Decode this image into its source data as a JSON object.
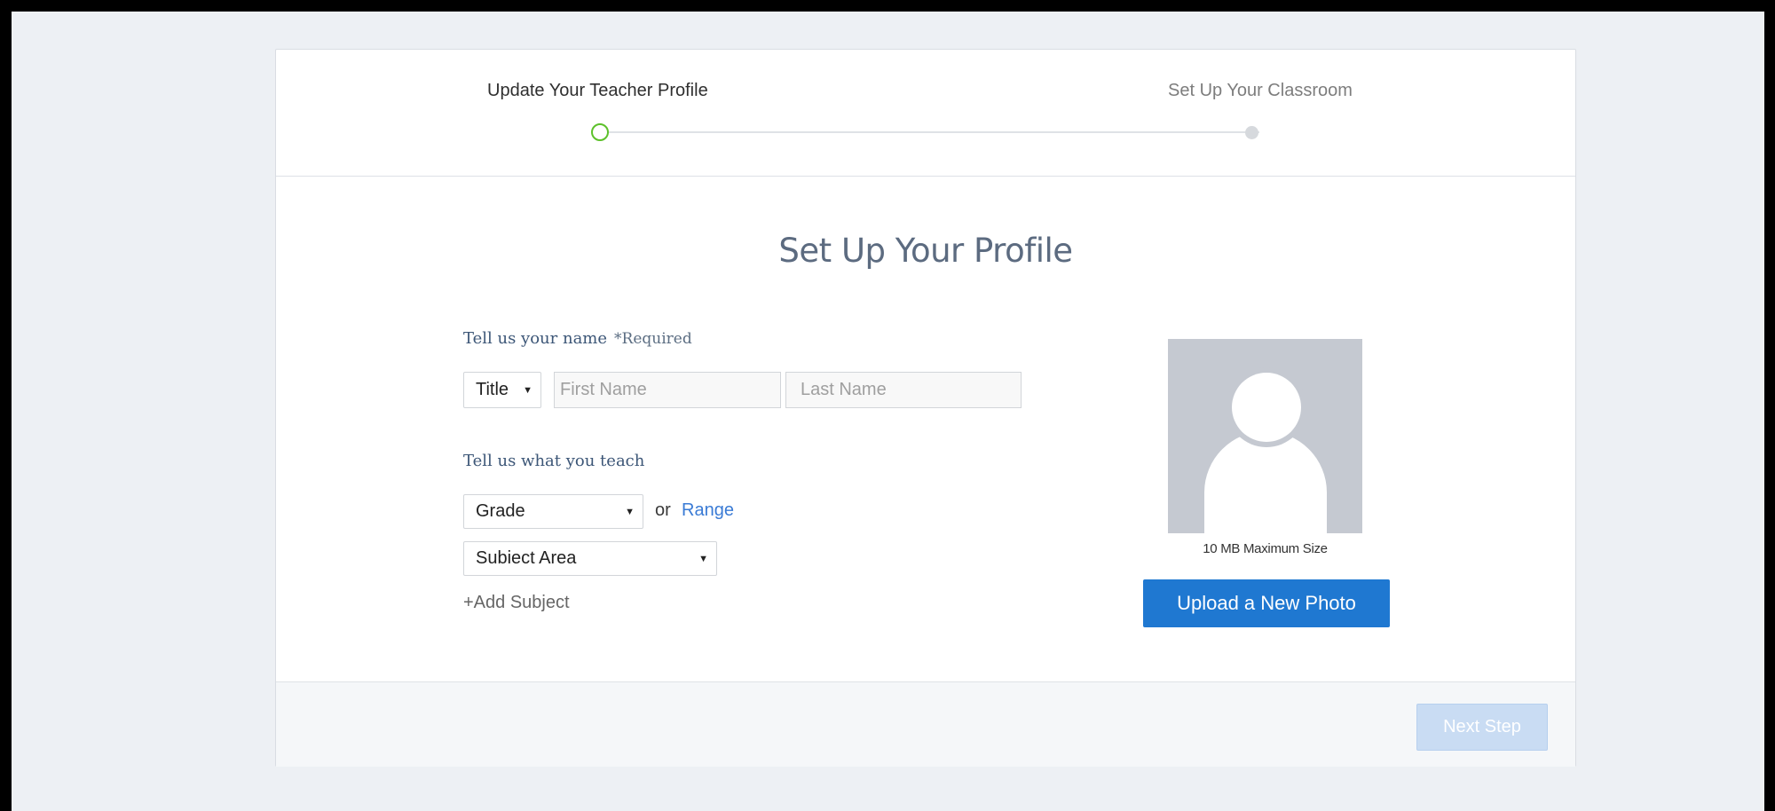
{
  "stepper": {
    "steps": [
      {
        "label": "Update Your Teacher Profile",
        "state": "active"
      },
      {
        "label": "Set Up Your Classroom",
        "state": "inactive"
      }
    ],
    "active_color": "#5dc12b"
  },
  "page": {
    "title": "Set Up Your Profile"
  },
  "name_section": {
    "label": "Tell us your name",
    "required_note": "*Required",
    "title_select": {
      "value": "Title",
      "caret": "▼"
    },
    "first_name": {
      "placeholder": "First Name",
      "value": ""
    },
    "last_name": {
      "placeholder": "Last Name",
      "value": ""
    }
  },
  "teach_section": {
    "label": "Tell us what you teach",
    "grade_select": {
      "value": "Grade",
      "caret": "▼"
    },
    "or_text": "or",
    "range_link": "Range",
    "subject_select": {
      "value": "Subiect Area",
      "caret": "▼"
    },
    "add_subject": "+Add Subject"
  },
  "photo": {
    "avatar_icon": "user-silhouette-icon",
    "max_size_note": "10 MB Maximum Size",
    "upload_label": "Upload a New Photo",
    "upload_color": "#1f78d1"
  },
  "footer": {
    "next_label": "Next Step",
    "next_enabled": false
  }
}
